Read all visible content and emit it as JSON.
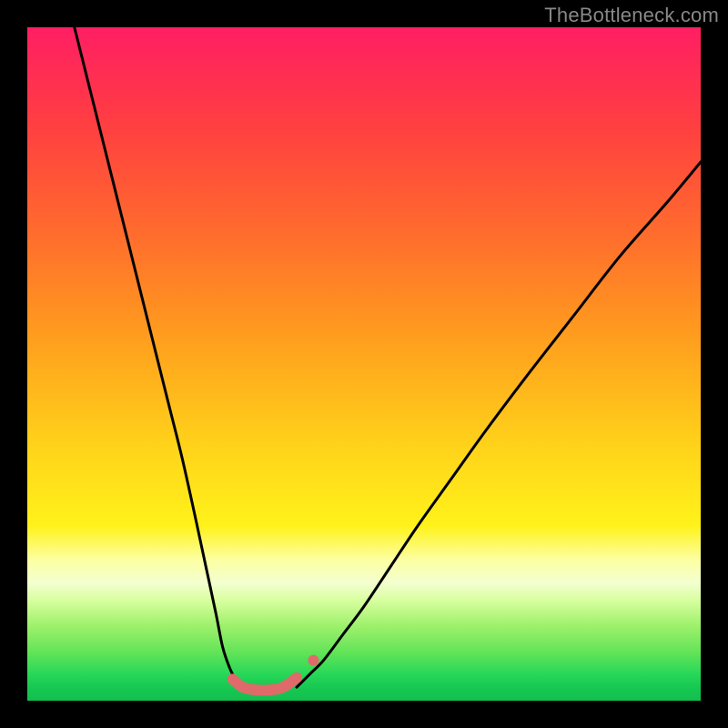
{
  "watermark": "TheBottleneck.com",
  "chart_data": {
    "type": "line",
    "title": "",
    "xlabel": "",
    "ylabel": "",
    "xlim": [
      0,
      100
    ],
    "ylim": [
      0,
      100
    ],
    "grid": false,
    "gradient_stops": [
      {
        "pct": 0,
        "color": "#ff1f63"
      },
      {
        "pct": 15,
        "color": "#ff4040"
      },
      {
        "pct": 30,
        "color": "#ff6a2e"
      },
      {
        "pct": 45,
        "color": "#ff9a1e"
      },
      {
        "pct": 62,
        "color": "#ffd21a"
      },
      {
        "pct": 74,
        "color": "#fff21a"
      },
      {
        "pct": 82,
        "color": "#f3ffd0"
      },
      {
        "pct": 89,
        "color": "#9cf06a"
      },
      {
        "pct": 96,
        "color": "#28d858"
      },
      {
        "pct": 100,
        "color": "#12bf4f"
      }
    ],
    "series": [
      {
        "name": "curve-left",
        "stroke": "#000000",
        "x": [
          7,
          9,
          11,
          13,
          15,
          17,
          19,
          21,
          23,
          25,
          26.5,
          28,
          29,
          30,
          31,
          32
        ],
        "values": [
          100,
          92,
          84,
          76,
          68,
          60,
          52,
          44,
          36,
          27,
          20,
          13,
          8,
          5,
          3,
          2
        ]
      },
      {
        "name": "curve-right",
        "stroke": "#000000",
        "x": [
          40,
          42,
          44,
          47,
          50,
          54,
          58,
          63,
          68,
          74,
          81,
          88,
          95,
          100
        ],
        "values": [
          2,
          4,
          6,
          10,
          14,
          20,
          26,
          33,
          40,
          48,
          57,
          66,
          74,
          80
        ]
      },
      {
        "name": "valley-floor",
        "stroke": "#e06a6a",
        "stroke_width": 12,
        "linecap": "round",
        "x": [
          30.5,
          32,
          34,
          36,
          38,
          40
        ],
        "values": [
          3.2,
          2.0,
          1.6,
          1.6,
          2.0,
          3.4
        ]
      }
    ],
    "markers": [
      {
        "name": "valley-dot-right",
        "x": 42.5,
        "y": 6,
        "r": 6,
        "color": "#e06a6a"
      }
    ]
  }
}
